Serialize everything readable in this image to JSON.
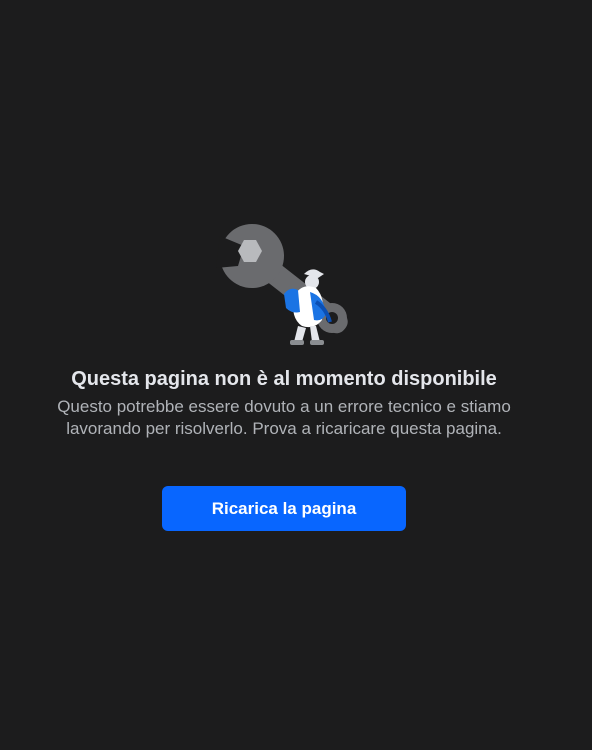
{
  "error": {
    "title": "Questa pagina non è al momento disponibile",
    "message": "Questo potrebbe essere dovuto a un errore tecnico e stiamo lavorando per risolverlo. Prova a ricaricare questa pagina.",
    "reload_button_label": "Ricarica la pagina",
    "illustration_icon": "wrench-with-worker-icon"
  },
  "colors": {
    "background": "#1c1c1d",
    "title": "#e4e6eb",
    "message": "#b0b3b8",
    "button": "#0866ff",
    "button_text": "#ffffff",
    "wrench": "#6a6b6e",
    "bolt": "#b8babd",
    "worker_blue": "#1b74e4"
  }
}
